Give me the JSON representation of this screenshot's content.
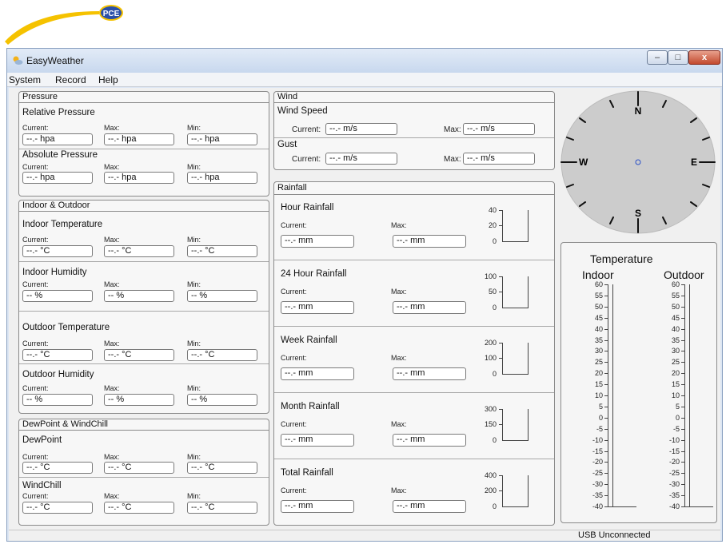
{
  "brand": {
    "logo_text": "PCE"
  },
  "window": {
    "title": "EasyWeather"
  },
  "menu": [
    "System",
    "Record",
    "Help"
  ],
  "pressure": {
    "title": "Pressure",
    "relative_title": "Relative Pressure",
    "absolute_title": "Absolute Pressure",
    "labels": {
      "current": "Current:",
      "max": "Max:",
      "min": "Min:"
    },
    "relative": {
      "current": "--.- hpa",
      "max": "--.- hpa",
      "min": "--.- hpa"
    },
    "absolute": {
      "current": "--.- hpa",
      "max": "--.- hpa",
      "min": "--.- hpa"
    }
  },
  "indoor_outdoor": {
    "title": "Indoor & Outdoor",
    "labels": {
      "current": "Current:",
      "max": "Max:",
      "min": "Min:"
    },
    "indoor_temp": {
      "title": "Indoor Temperature",
      "current": "--.- °C",
      "max": "--.- °C",
      "min": "--.- °C"
    },
    "indoor_humidity": {
      "title": "Indoor Humidity",
      "current": "-- %",
      "max": "-- %",
      "min": "-- %"
    },
    "outdoor_temp": {
      "title": "Outdoor Temperature",
      "current": "--.- °C",
      "max": "--.- °C",
      "min": "--.- °C"
    },
    "outdoor_humidity": {
      "title": "Outdoor Humidity",
      "current": "-- %",
      "max": "-- %",
      "min": "-- %"
    }
  },
  "dew_wind": {
    "title": "DewPoint & WindChill",
    "labels": {
      "current": "Current:",
      "max": "Max:",
      "min": "Min:"
    },
    "dewpoint": {
      "title": "DewPoint",
      "current": "--.- °C",
      "max": "--.- °C",
      "min": "--.- °C"
    },
    "windchill": {
      "title": "WindChill",
      "current": "--.- °C",
      "max": "--.- °C",
      "min": "--.- °C"
    }
  },
  "wind": {
    "title": "Wind",
    "speed_title": "Wind Speed",
    "gust_title": "Gust",
    "current_label": "Current:",
    "max_label": "Max:",
    "speed": {
      "current": "--.- m/s",
      "max": "--.- m/s"
    },
    "gust": {
      "current": "--.- m/s",
      "max": "--.- m/s"
    }
  },
  "rainfall": {
    "title": "Rainfall",
    "current_label": "Current:",
    "max_label": "Max:",
    "sections": [
      {
        "title": "Hour Rainfall",
        "current": "--.- mm",
        "max": "--.- mm",
        "ticks": [
          "40",
          "20",
          "0"
        ]
      },
      {
        "title": "24 Hour Rainfall",
        "current": "--.- mm",
        "max": "--.- mm",
        "ticks": [
          "100",
          "50",
          "0"
        ]
      },
      {
        "title": "Week Rainfall",
        "current": "--.- mm",
        "max": "--.- mm",
        "ticks": [
          "200",
          "100",
          "0"
        ]
      },
      {
        "title": "Month Rainfall",
        "current": "--.- mm",
        "max": "--.- mm",
        "ticks": [
          "300",
          "150",
          "0"
        ]
      },
      {
        "title": "Total Rainfall",
        "current": "--.- mm",
        "max": "--.- mm",
        "ticks": [
          "400",
          "200",
          "0"
        ]
      }
    ]
  },
  "compass": {
    "north": "N",
    "south": "S",
    "east": "E",
    "west": "W"
  },
  "temperature": {
    "title": "Temperature",
    "indoor_label": "Indoor",
    "outdoor_label": "Outdoor",
    "scale": [
      "60",
      "55",
      "50",
      "45",
      "40",
      "35",
      "30",
      "25",
      "20",
      "15",
      "10",
      "5",
      "0",
      "-5",
      "-10",
      "-15",
      "-20",
      "-25",
      "-30",
      "-35",
      "-40"
    ]
  },
  "status": {
    "text": "USB Unconnected"
  },
  "colors": {
    "compass_bg": "#cccccc",
    "brand_yellow": "#f5c200",
    "brand_blue": "#2a4fa8"
  }
}
